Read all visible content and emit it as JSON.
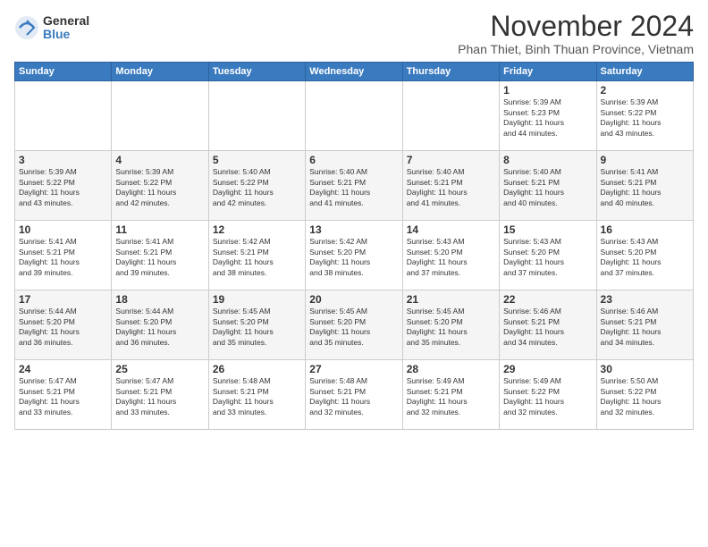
{
  "logo": {
    "general": "General",
    "blue": "Blue"
  },
  "title": "November 2024",
  "subtitle": "Phan Thiet, Binh Thuan Province, Vietnam",
  "headers": [
    "Sunday",
    "Monday",
    "Tuesday",
    "Wednesday",
    "Thursday",
    "Friday",
    "Saturday"
  ],
  "weeks": [
    [
      {
        "day": "",
        "info": ""
      },
      {
        "day": "",
        "info": ""
      },
      {
        "day": "",
        "info": ""
      },
      {
        "day": "",
        "info": ""
      },
      {
        "day": "",
        "info": ""
      },
      {
        "day": "1",
        "info": "Sunrise: 5:39 AM\nSunset: 5:23 PM\nDaylight: 11 hours\nand 44 minutes."
      },
      {
        "day": "2",
        "info": "Sunrise: 5:39 AM\nSunset: 5:22 PM\nDaylight: 11 hours\nand 43 minutes."
      }
    ],
    [
      {
        "day": "3",
        "info": "Sunrise: 5:39 AM\nSunset: 5:22 PM\nDaylight: 11 hours\nand 43 minutes."
      },
      {
        "day": "4",
        "info": "Sunrise: 5:39 AM\nSunset: 5:22 PM\nDaylight: 11 hours\nand 42 minutes."
      },
      {
        "day": "5",
        "info": "Sunrise: 5:40 AM\nSunset: 5:22 PM\nDaylight: 11 hours\nand 42 minutes."
      },
      {
        "day": "6",
        "info": "Sunrise: 5:40 AM\nSunset: 5:21 PM\nDaylight: 11 hours\nand 41 minutes."
      },
      {
        "day": "7",
        "info": "Sunrise: 5:40 AM\nSunset: 5:21 PM\nDaylight: 11 hours\nand 41 minutes."
      },
      {
        "day": "8",
        "info": "Sunrise: 5:40 AM\nSunset: 5:21 PM\nDaylight: 11 hours\nand 40 minutes."
      },
      {
        "day": "9",
        "info": "Sunrise: 5:41 AM\nSunset: 5:21 PM\nDaylight: 11 hours\nand 40 minutes."
      }
    ],
    [
      {
        "day": "10",
        "info": "Sunrise: 5:41 AM\nSunset: 5:21 PM\nDaylight: 11 hours\nand 39 minutes."
      },
      {
        "day": "11",
        "info": "Sunrise: 5:41 AM\nSunset: 5:21 PM\nDaylight: 11 hours\nand 39 minutes."
      },
      {
        "day": "12",
        "info": "Sunrise: 5:42 AM\nSunset: 5:21 PM\nDaylight: 11 hours\nand 38 minutes."
      },
      {
        "day": "13",
        "info": "Sunrise: 5:42 AM\nSunset: 5:20 PM\nDaylight: 11 hours\nand 38 minutes."
      },
      {
        "day": "14",
        "info": "Sunrise: 5:43 AM\nSunset: 5:20 PM\nDaylight: 11 hours\nand 37 minutes."
      },
      {
        "day": "15",
        "info": "Sunrise: 5:43 AM\nSunset: 5:20 PM\nDaylight: 11 hours\nand 37 minutes."
      },
      {
        "day": "16",
        "info": "Sunrise: 5:43 AM\nSunset: 5:20 PM\nDaylight: 11 hours\nand 37 minutes."
      }
    ],
    [
      {
        "day": "17",
        "info": "Sunrise: 5:44 AM\nSunset: 5:20 PM\nDaylight: 11 hours\nand 36 minutes."
      },
      {
        "day": "18",
        "info": "Sunrise: 5:44 AM\nSunset: 5:20 PM\nDaylight: 11 hours\nand 36 minutes."
      },
      {
        "day": "19",
        "info": "Sunrise: 5:45 AM\nSunset: 5:20 PM\nDaylight: 11 hours\nand 35 minutes."
      },
      {
        "day": "20",
        "info": "Sunrise: 5:45 AM\nSunset: 5:20 PM\nDaylight: 11 hours\nand 35 minutes."
      },
      {
        "day": "21",
        "info": "Sunrise: 5:45 AM\nSunset: 5:20 PM\nDaylight: 11 hours\nand 35 minutes."
      },
      {
        "day": "22",
        "info": "Sunrise: 5:46 AM\nSunset: 5:21 PM\nDaylight: 11 hours\nand 34 minutes."
      },
      {
        "day": "23",
        "info": "Sunrise: 5:46 AM\nSunset: 5:21 PM\nDaylight: 11 hours\nand 34 minutes."
      }
    ],
    [
      {
        "day": "24",
        "info": "Sunrise: 5:47 AM\nSunset: 5:21 PM\nDaylight: 11 hours\nand 33 minutes."
      },
      {
        "day": "25",
        "info": "Sunrise: 5:47 AM\nSunset: 5:21 PM\nDaylight: 11 hours\nand 33 minutes."
      },
      {
        "day": "26",
        "info": "Sunrise: 5:48 AM\nSunset: 5:21 PM\nDaylight: 11 hours\nand 33 minutes."
      },
      {
        "day": "27",
        "info": "Sunrise: 5:48 AM\nSunset: 5:21 PM\nDaylight: 11 hours\nand 32 minutes."
      },
      {
        "day": "28",
        "info": "Sunrise: 5:49 AM\nSunset: 5:21 PM\nDaylight: 11 hours\nand 32 minutes."
      },
      {
        "day": "29",
        "info": "Sunrise: 5:49 AM\nSunset: 5:22 PM\nDaylight: 11 hours\nand 32 minutes."
      },
      {
        "day": "30",
        "info": "Sunrise: 5:50 AM\nSunset: 5:22 PM\nDaylight: 11 hours\nand 32 minutes."
      }
    ]
  ]
}
